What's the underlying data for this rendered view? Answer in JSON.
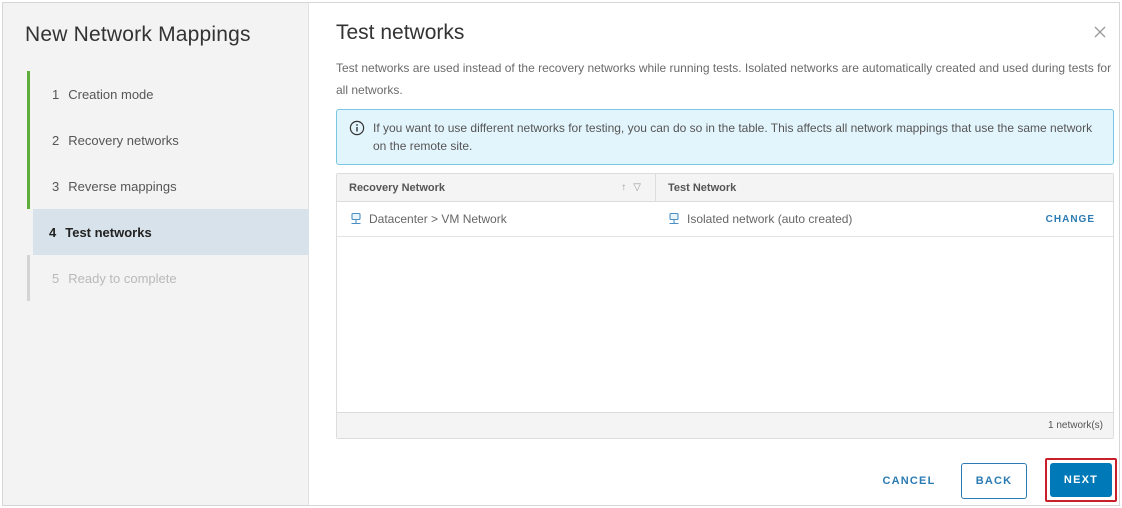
{
  "wizard": {
    "title": "New Network Mappings",
    "steps": [
      {
        "num": "1",
        "label": "Creation mode",
        "state": "completed"
      },
      {
        "num": "2",
        "label": "Recovery networks",
        "state": "completed"
      },
      {
        "num": "3",
        "label": "Reverse mappings",
        "state": "completed"
      },
      {
        "num": "4",
        "label": "Test networks",
        "state": "active"
      },
      {
        "num": "5",
        "label": "Ready to complete",
        "state": "disabled"
      }
    ]
  },
  "page": {
    "title": "Test networks",
    "description": "Test networks are used instead of the recovery networks while running tests. Isolated networks are automatically created and used during tests for all networks.",
    "close_icon": "close-icon"
  },
  "alert": {
    "icon": "info-icon",
    "text": "If you want to use different networks for testing, you can do so in the table. This affects all network mappings that use the same network on the remote site."
  },
  "grid": {
    "columns": {
      "recovery": "Recovery Network",
      "test": "Test Network"
    },
    "sort_icons": {
      "sort": "↑",
      "filter": "▽"
    },
    "rows": [
      {
        "recovery": "Datacenter > VM Network",
        "test": "Isolated network (auto created)",
        "action": "CHANGE"
      }
    ],
    "footer": "1 network(s)"
  },
  "buttons": {
    "cancel": "CANCEL",
    "back": "BACK",
    "next": "NEXT"
  },
  "colors": {
    "primary": "#0079b8",
    "link": "#2b7bb3",
    "completed_step": "#5ead3a",
    "highlight_border": "#c8202a"
  }
}
